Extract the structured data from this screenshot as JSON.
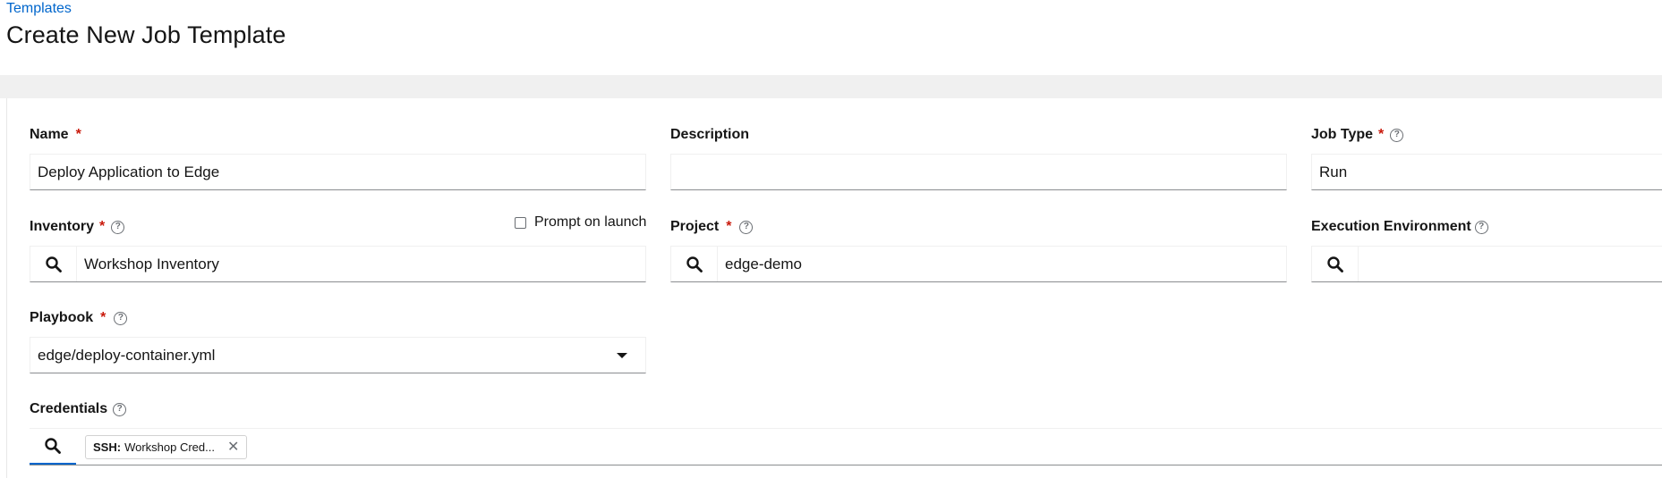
{
  "breadcrumb": {
    "parent": "Templates"
  },
  "page": {
    "title": "Create New Job Template"
  },
  "form": {
    "name": {
      "label": "Name",
      "value": "Deploy Application to Edge"
    },
    "description": {
      "label": "Description",
      "value": ""
    },
    "job_type": {
      "label": "Job Type",
      "value": "Run"
    },
    "inventory": {
      "label": "Inventory",
      "value": "Workshop Inventory",
      "prompt_label": "Prompt on launch"
    },
    "project": {
      "label": "Project",
      "value": "edge-demo"
    },
    "execution_environment": {
      "label": "Execution Environment",
      "value": ""
    },
    "playbook": {
      "label": "Playbook",
      "value": "edge/deploy-container.yml"
    },
    "credentials": {
      "label": "Credentials",
      "chips": [
        {
          "type": "SSH:",
          "name": "Workshop Cred..."
        }
      ]
    }
  },
  "icons": {
    "help": "?",
    "remove": "✕"
  },
  "colors": {
    "link": "#0066cc",
    "required": "#c9190b",
    "band": "#f0f0f0"
  }
}
